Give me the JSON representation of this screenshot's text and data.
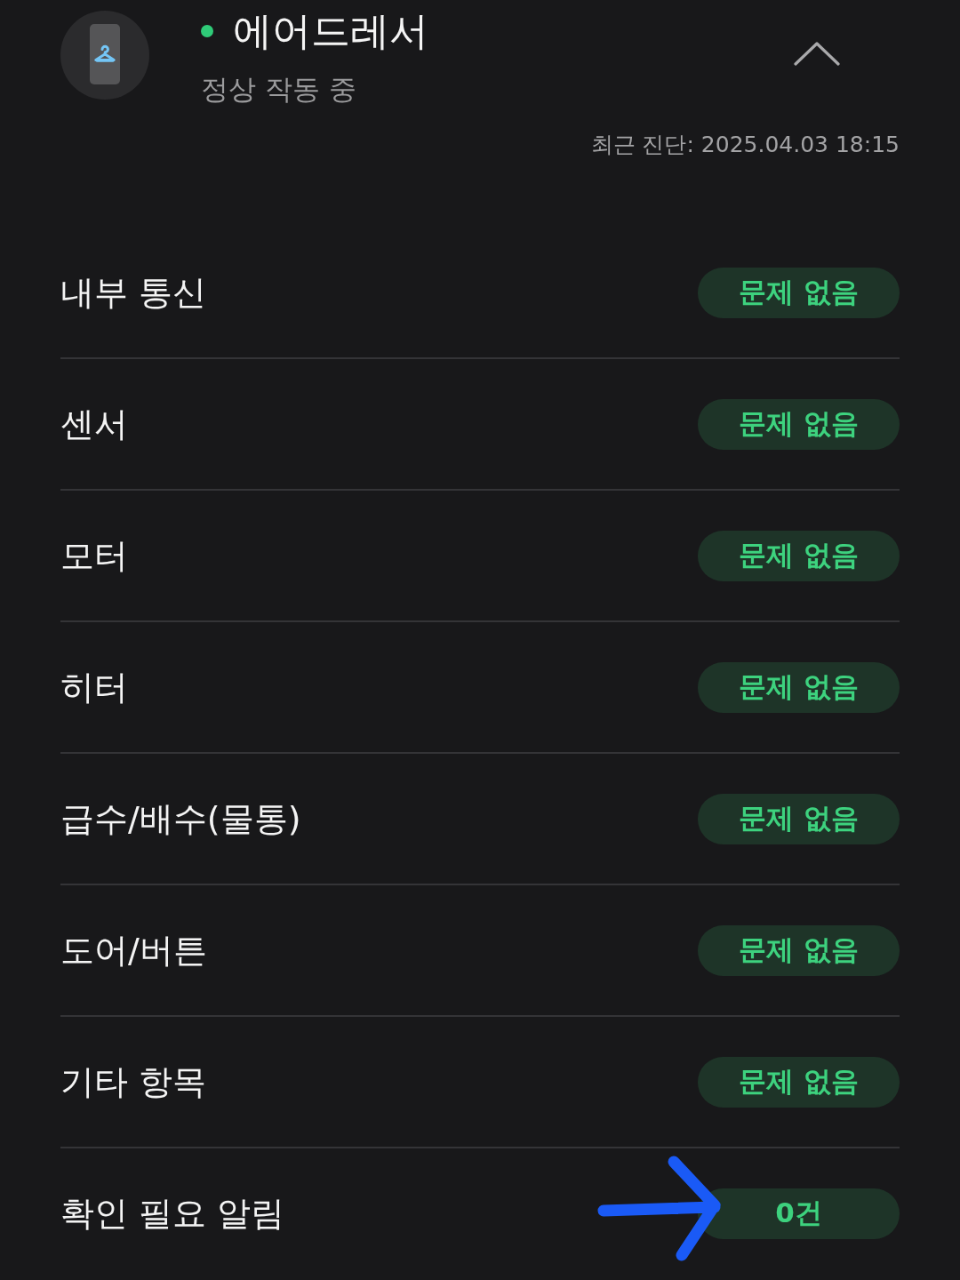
{
  "device": {
    "name": "에어드레서",
    "online": true,
    "status": "정상 작동 중",
    "expanded": true
  },
  "last_diagnosis": "최근 진단: 2025.04.03 18:15",
  "items": [
    {
      "label": "내부 통신",
      "result": "문제 없음",
      "annotated": false
    },
    {
      "label": "센서",
      "result": "문제 없음",
      "annotated": false
    },
    {
      "label": "모터",
      "result": "문제 없음",
      "annotated": false
    },
    {
      "label": "히터",
      "result": "문제 없음",
      "annotated": false
    },
    {
      "label": "급수/배수(물통)",
      "result": "문제 없음",
      "annotated": false
    },
    {
      "label": "도어/버튼",
      "result": "문제 없음",
      "annotated": false
    },
    {
      "label": "기타 항목",
      "result": "문제 없음",
      "annotated": false
    },
    {
      "label": "확인 필요 알림",
      "result": "0건",
      "annotated": true
    }
  ]
}
